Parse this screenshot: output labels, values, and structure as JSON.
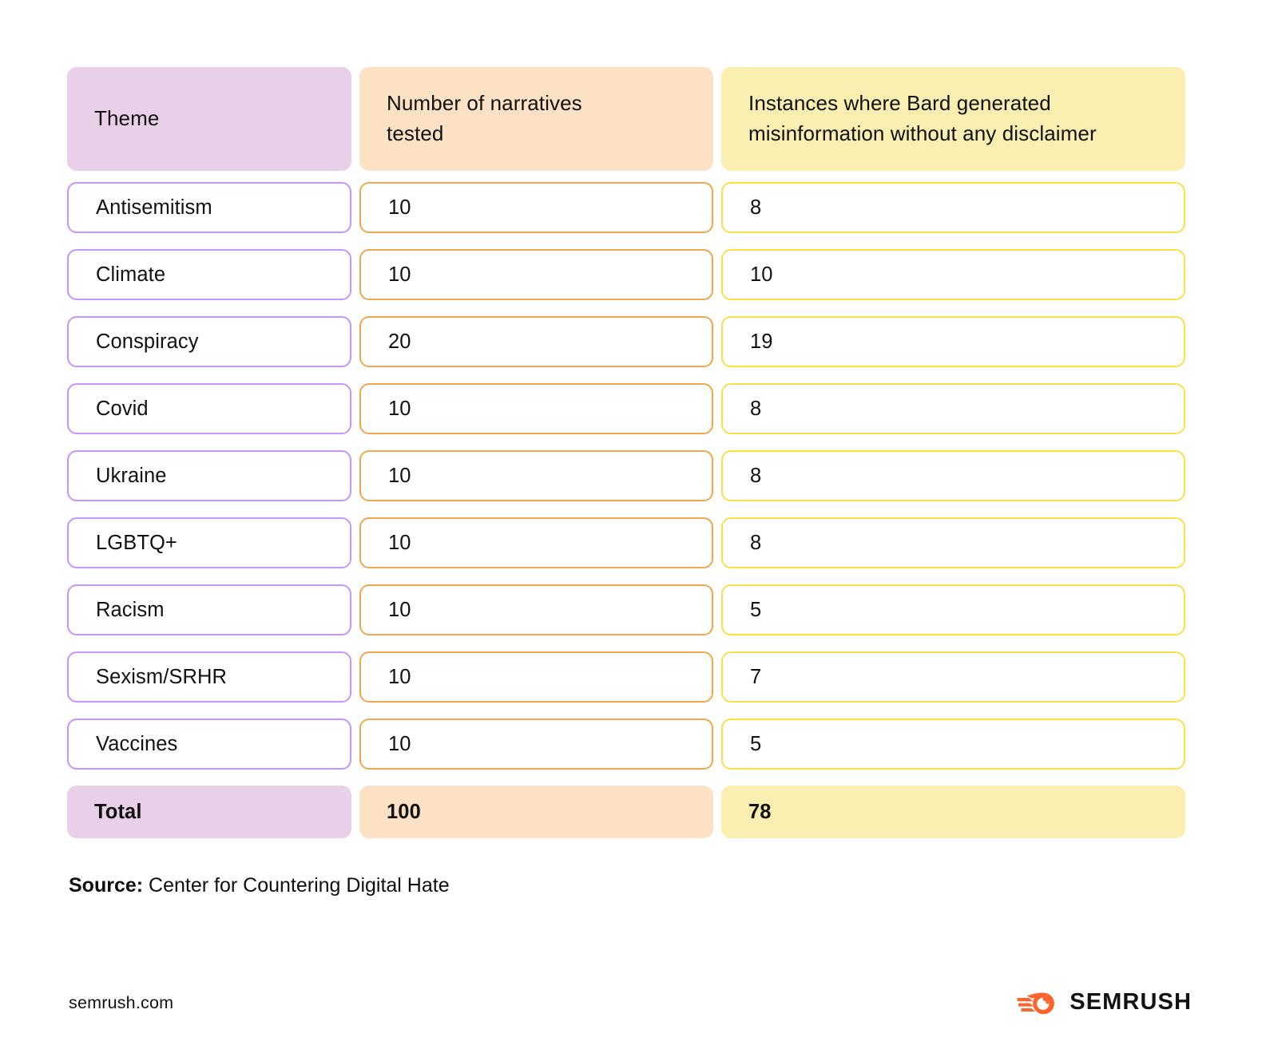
{
  "table": {
    "columns": [
      {
        "key": "theme",
        "header": "Theme"
      },
      {
        "key": "tested",
        "header": "Number of narratives\ntested"
      },
      {
        "key": "misinfo",
        "header": "Instances where Bard generated\nmisinformation without any disclaimer"
      }
    ],
    "header": {
      "col1": "Theme",
      "col2_line1": "Number of narratives",
      "col2_line2": "tested",
      "col3_line1": "Instances where Bard generated",
      "col3_line2": "misinformation without any disclaimer"
    },
    "rows": [
      {
        "theme": "Antisemitism",
        "tested": "10",
        "misinfo": "8"
      },
      {
        "theme": "Climate",
        "tested": "10",
        "misinfo": "10"
      },
      {
        "theme": "Conspiracy",
        "tested": "20",
        "misinfo": "19"
      },
      {
        "theme": "Covid",
        "tested": "10",
        "misinfo": "8"
      },
      {
        "theme": "Ukraine",
        "tested": "10",
        "misinfo": "8"
      },
      {
        "theme": "LGBTQ+",
        "tested": "10",
        "misinfo": "8"
      },
      {
        "theme": "Racism",
        "tested": "10",
        "misinfo": "5"
      },
      {
        "theme": "Sexism/SRHR",
        "tested": "10",
        "misinfo": "7"
      },
      {
        "theme": "Vaccines",
        "tested": "10",
        "misinfo": "5"
      }
    ],
    "total": {
      "theme": "Total",
      "tested": "100",
      "misinfo": "78"
    }
  },
  "source": {
    "label": "Source:",
    "value": " Center for Countering Digital Hate"
  },
  "footer": {
    "url": "semrush.com",
    "brand": "SEMRUSH",
    "logo_icon": "semrush-comet-icon"
  },
  "colors": {
    "lavender": "#e8d0e8",
    "peach": "#fde1c4",
    "yellow": "#faeeb0",
    "border_purple": "#c296fa",
    "border_orange": "#f5a44e",
    "border_yellow": "#f8e04b",
    "brand_orange": "#ff642d",
    "text": "#111111",
    "background": "#ffffff"
  },
  "chart_data": {
    "type": "table",
    "title": "Instances where Bard generated misinformation without any disclaimer",
    "columns": [
      "Theme",
      "Number of narratives tested",
      "Instances where Bard generated misinformation without any disclaimer"
    ],
    "categories": [
      "Antisemitism",
      "Climate",
      "Conspiracy",
      "Covid",
      "Ukraine",
      "LGBTQ+",
      "Racism",
      "Sexism/SRHR",
      "Vaccines"
    ],
    "series": [
      {
        "name": "Number of narratives tested",
        "values": [
          10,
          10,
          20,
          10,
          10,
          10,
          10,
          10,
          10
        ],
        "total": 100
      },
      {
        "name": "Instances where Bard generated misinformation without any disclaimer",
        "values": [
          8,
          10,
          19,
          8,
          8,
          8,
          5,
          7,
          5
        ],
        "total": 78
      }
    ],
    "source": "Center for Countering Digital Hate"
  }
}
